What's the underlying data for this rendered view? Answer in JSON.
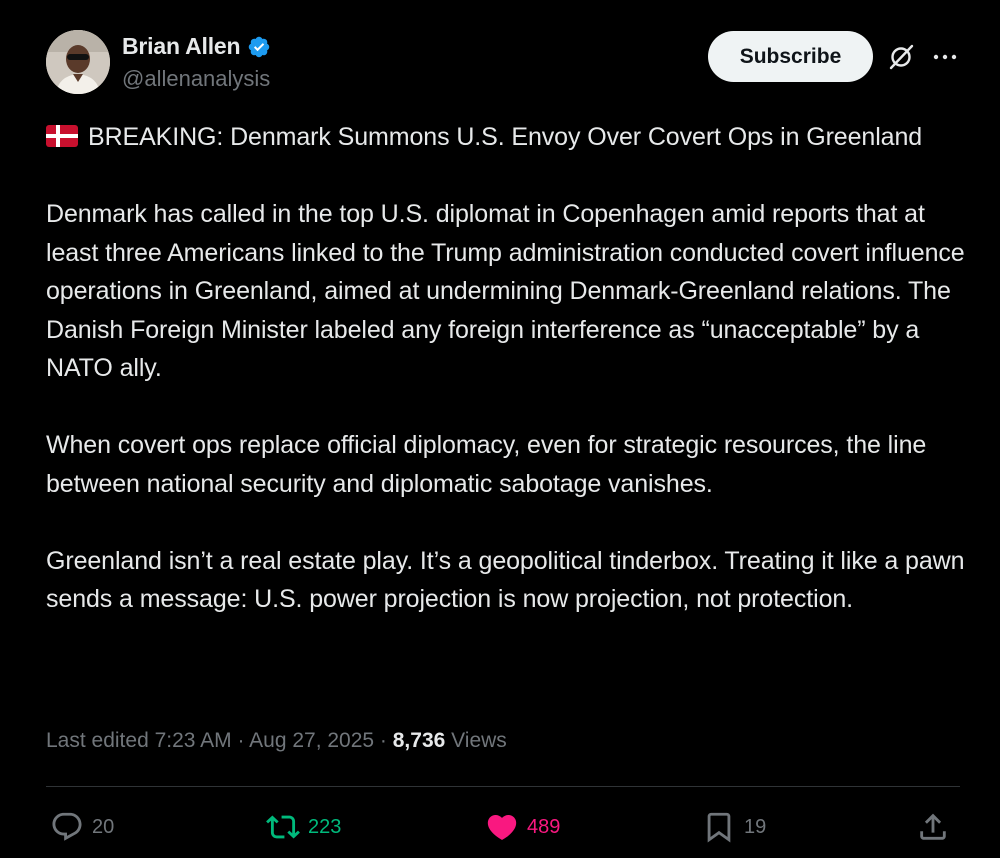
{
  "author": {
    "display_name": "Brian Allen",
    "handle": "@allenanalysis",
    "verified": true,
    "verified_color": "#1d9bf0"
  },
  "header": {
    "subscribe_label": "Subscribe",
    "grok_icon": "grok-icon",
    "more_icon": "more-icon"
  },
  "tweet": {
    "flag_icon": "denmark-flag-icon",
    "headline": "BREAKING: Denmark Summons U.S. Envoy Over Covert Ops in Greenland",
    "paragraphs": [
      "Denmark has called in the top U.S. diplomat in Copenhagen amid reports that at least three Americans linked to the Trump administration conducted covert influence operations in Greenland, aimed at undermining Denmark-Greenland relations. The Danish Foreign Minister labeled any foreign interference as “unacceptable” by a NATO ally.",
      "When covert ops replace official diplomacy, even for strategic resources, the line between national security and diplomatic sabotage vanishes.",
      "Greenland isn’t a real estate play. It’s a geopolitical tinderbox. Treating it like a pawn sends a message: U.S. power projection is now projection, not protection."
    ]
  },
  "meta": {
    "edited_label": "Last edited 7:23 AM · Aug 27, 2025 · ",
    "views_count": "8,736",
    "views_label": " Views"
  },
  "actions": {
    "replies": "20",
    "reposts": "223",
    "likes": "489",
    "bookmarks": "19",
    "repost_color": "#00ba7c",
    "like_color": "#f91880"
  }
}
